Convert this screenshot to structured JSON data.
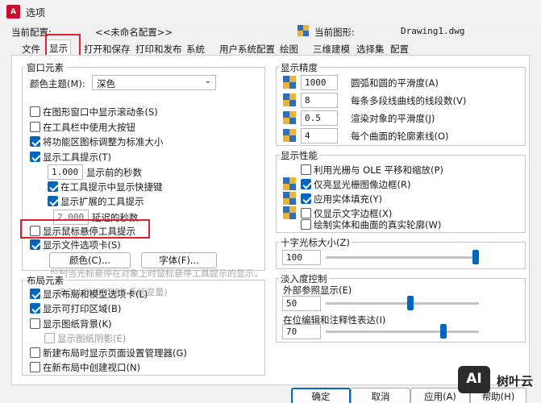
{
  "window": {
    "title": "选项",
    "app_icon": "A"
  },
  "header": {
    "current_profile_label": "当前配置:",
    "current_profile_value": "<<未命名配置>>",
    "current_drawing_label": "当前图形:",
    "current_drawing_value": "Drawing1.dwg"
  },
  "tabs": [
    "文件",
    "显示",
    "打开和保存",
    "打印和发布",
    "系统",
    "用户系统配置",
    "绘图",
    "三维建模",
    "选择集",
    "配置"
  ],
  "window_elements": {
    "title": "窗口元素",
    "color_theme_label": "颜色主题(M):",
    "color_theme_value": "深色",
    "options": [
      "在图形窗口中显示滚动条(S)",
      "在工具栏中使用大按钮",
      "将功能区图标调整为标准大小",
      "显示工具提示(T)"
    ],
    "tooltip_delay_value": "1.000",
    "tooltip_delay_label": "显示前的秒数",
    "sub_options": [
      "在工具提示中显示快捷键",
      "显示扩展的工具提示"
    ],
    "ext_delay_value": "2.000",
    "ext_delay_label": "延迟的秒数",
    "rollover_label": "显示鼠标悬停工具提示",
    "file_tabs_label": "显示文件选项卡(S)",
    "colors_button": "颜色(C)...",
    "fonts_button": "字体(F)..."
  },
  "ghost_tooltip": {
    "line1": "控制当光标悬停在对象上时鼠标悬停工具提示的显示。",
    "line2": "(ROLLOVERTIPS 系统变量)"
  },
  "layout_elements": {
    "title": "布局元素",
    "options": [
      "显示布局和模型选项卡(L)",
      "显示可打印区域(B)",
      "显示图纸背景(K)"
    ],
    "paper_shadow": "显示图纸阴影(E)",
    "options2": [
      "新建布局时显示页面设置管理器(G)",
      "在新布局中创建视口(N)"
    ]
  },
  "display_resolution": {
    "title": "显示精度",
    "rows": [
      {
        "value": "1000",
        "label": "圆弧和圆的平滑度(A)"
      },
      {
        "value": "8",
        "label": "每条多段线曲线的线段数(V)"
      },
      {
        "value": "0.5",
        "label": "渲染对象的平滑度(J)"
      },
      {
        "value": "4",
        "label": "每个曲面的轮廓素线(O)"
      }
    ]
  },
  "display_performance": {
    "title": "显示性能",
    "options": [
      "利用光栅与 OLE 平移和缩放(P)",
      "仅亮显光栅图像边框(R)",
      "应用实体填充(Y)",
      "仅显示文字边框(X)",
      "绘制实体和曲面的真实轮廓(W)"
    ]
  },
  "crosshair": {
    "title": "十字光标大小(Z)",
    "value": "100",
    "level_percent": 100
  },
  "fade_control": {
    "title": "淡入度控制",
    "xref_label": "外部参照显示(E)",
    "xref_value": "50",
    "inplace_label": "在位编辑和注释性表达(I)",
    "inplace_value": "70"
  },
  "footer": {
    "ok": "确定",
    "cancel": "取消",
    "apply": "应用(A)",
    "help": "帮助(H)"
  },
  "brand": {
    "logo_text": "AI",
    "name": "树叶云"
  },
  "colors": {
    "accent": "#0067c0",
    "highlight_box": "#e0202a",
    "title_bg": "#f3f3f3"
  }
}
